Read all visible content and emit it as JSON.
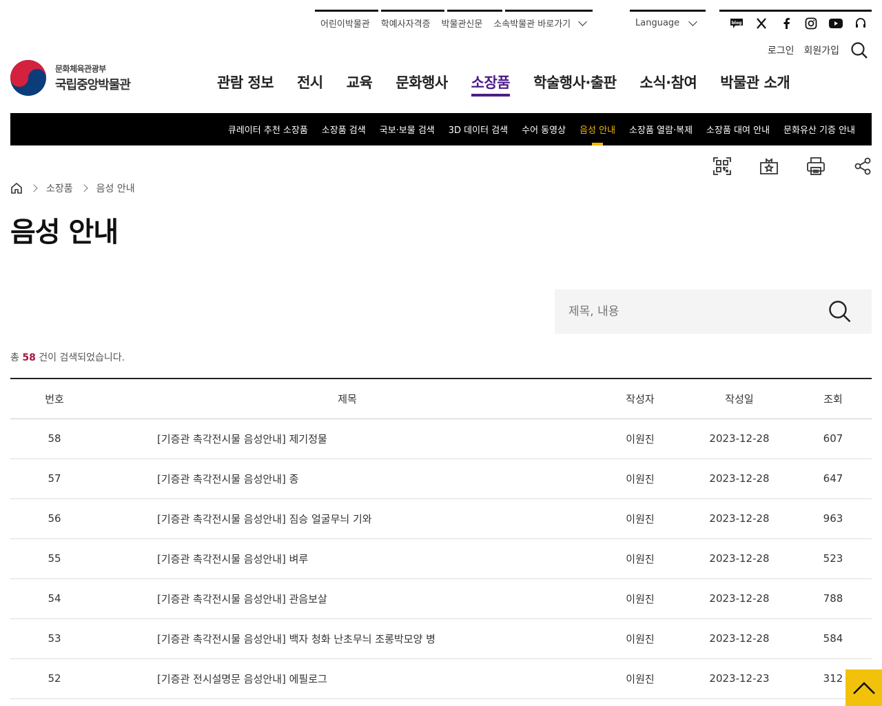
{
  "util": {
    "links": [
      "어린이박물관",
      "학예사자격증",
      "박물관신문",
      "소속박물관 바로가기"
    ],
    "language": "Language",
    "sns": [
      "blog-icon",
      "x-icon",
      "facebook-icon",
      "instagram-icon",
      "youtube-icon",
      "headset-icon"
    ],
    "blog_text": "blog"
  },
  "auth": {
    "login": "로그인",
    "join": "회원가입"
  },
  "logo": {
    "ministry": "문화체육관광부",
    "name": "국립중앙박물관"
  },
  "gnb": [
    "관람 정보",
    "전시",
    "교육",
    "문화행사",
    "소장품",
    "학술행사·출판",
    "소식·참여",
    "박물관 소개"
  ],
  "gnb_active": "소장품",
  "subnav": [
    "큐레이터 추천 소장품",
    "소장품 검색",
    "국보·보물 검색",
    "3D 데이터 검색",
    "수어 동영상",
    "음성 안내",
    "소장품 열람·복제",
    "소장품 대여 안내",
    "문화유산 기증 안내"
  ],
  "subnav_active": "음성 안내",
  "breadcrumb": [
    "소장품",
    "음성 안내"
  ],
  "page_title": "음성 안내",
  "search": {
    "placeholder": "제목, 내용"
  },
  "count": {
    "prefix": "총",
    "number": "58",
    "suffix": "건이 검색되었습니다."
  },
  "table": {
    "headers": [
      "번호",
      "제목",
      "작성자",
      "작성일",
      "조회"
    ],
    "rows": [
      [
        "58",
        "[기증관 촉각전시물 음성안내] 제기정물",
        "이원진",
        "2023-12-28",
        "607"
      ],
      [
        "57",
        "[기증관 촉각전시물 음성안내] 종",
        "이원진",
        "2023-12-28",
        "647"
      ],
      [
        "56",
        "[기증관 촉각전시물 음성안내] 짐승 얼굴무늬 기와",
        "이원진",
        "2023-12-28",
        "963"
      ],
      [
        "55",
        "[기증관 촉각전시물 음성안내] 벼루",
        "이원진",
        "2023-12-28",
        "523"
      ],
      [
        "54",
        "[기증관 촉각전시물 음성안내] 관음보살",
        "이원진",
        "2023-12-28",
        "788"
      ],
      [
        "53",
        "[기증관 촉각전시물 음성안내] 백자 청화 난초무늬 조롱박모양 병",
        "이원진",
        "2023-12-28",
        "584"
      ],
      [
        "52",
        "[기증관 전시설명문 음성안내] 에필로그",
        "이원진",
        "2023-12-23",
        "312"
      ]
    ]
  },
  "colors": {
    "accent": "#4b1d88",
    "sub_active": "#f2b705",
    "count": "#a3163d",
    "top_btn": "#f2c20a"
  }
}
